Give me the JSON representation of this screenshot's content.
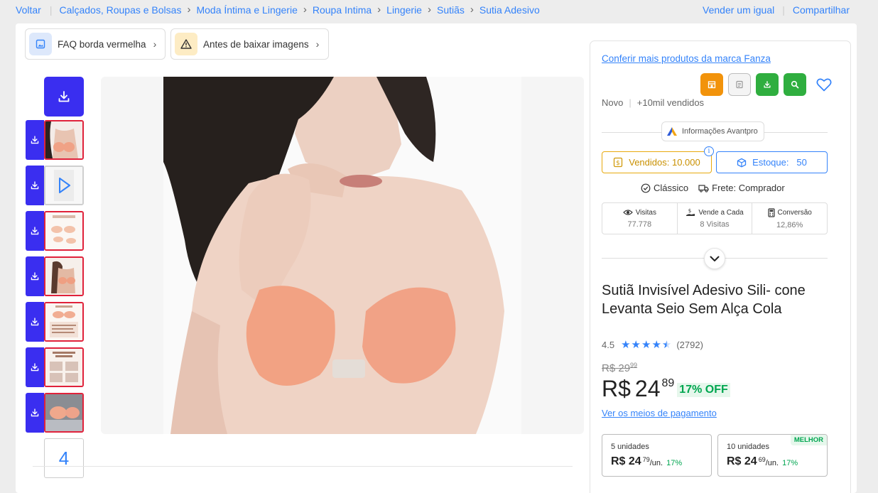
{
  "breadcrumb": {
    "back": "Voltar",
    "items": [
      "Calçados, Roupas e Bolsas",
      "Moda Íntima e Lingerie",
      "Roupa Intima",
      "Lingerie",
      "Sutiãs",
      "Sutia Adesivo"
    ]
  },
  "top_actions": {
    "sell": "Vender um igual",
    "share": "Compartilhar"
  },
  "chips": {
    "faq": "FAQ borda vermelha",
    "warning": "Antes de baixar imagens"
  },
  "gallery": {
    "more_count": "4"
  },
  "panel": {
    "brand_link": "Conferir mais produtos da marca Fanza",
    "condition": "Novo",
    "sold_summary": "+10mil vendidos",
    "avantpro": "Informações Avantpro",
    "sold_label": "Vendidos:",
    "sold_value": "10.000",
    "stock_label": "Estoque:",
    "stock_value": "50",
    "listing_type": "Clássico",
    "shipping": "Frete: Comprador",
    "stats": [
      {
        "label": "Visitas",
        "value": "77.778"
      },
      {
        "label": "Vende a Cada",
        "value": "8 Visitas"
      },
      {
        "label": "Conversão",
        "value": "12,86%"
      }
    ],
    "title": "Sutiã Invisível Adesivo Sili- cone Levanta Seio Sem Alça Cola",
    "rating": "4.5",
    "stars_value": 4.5,
    "reviews": "(2792)",
    "old_price": {
      "currency": "R$",
      "int": "29",
      "cents": "99"
    },
    "price": {
      "currency": "R$",
      "int": "24",
      "cents": "89",
      "off": "17% OFF"
    },
    "payment_link": "Ver os meios de pagamento",
    "bulk": [
      {
        "qty": "5 unidades",
        "currency": "R$",
        "int": "24",
        "cents": "79",
        "unit": "/un.",
        "pct": "17%",
        "badge": ""
      },
      {
        "qty": "10 unidades",
        "currency": "R$",
        "int": "24",
        "cents": "69",
        "unit": "/un.",
        "pct": "17%",
        "badge": "MELHOR"
      }
    ]
  },
  "colors": {
    "accent": "#3483fa",
    "download_btn": "#3a2ef0",
    "thumb_border": "#e0223b",
    "sold_border": "#e8a90e",
    "discount": "#00a650",
    "tool_orange": "#f2930b",
    "tool_green": "#2fae3f"
  }
}
